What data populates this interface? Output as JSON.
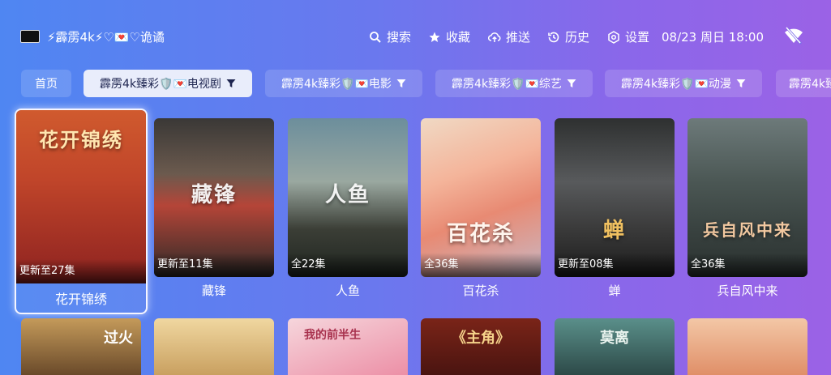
{
  "header": {
    "brand": "⚡霹雳4k⚡♡💌♡诡谲",
    "nav": [
      {
        "icon": "search-icon",
        "label": "搜索"
      },
      {
        "icon": "star-icon",
        "label": "收藏"
      },
      {
        "icon": "cloud-upload-icon",
        "label": "推送"
      },
      {
        "icon": "history-icon",
        "label": "历史"
      },
      {
        "icon": "settings-icon",
        "label": "设置"
      }
    ],
    "datetime": "08/23 周日 18:00",
    "status_icon": "wifi-off-icon"
  },
  "tabs": [
    {
      "label": "首页"
    },
    {
      "label": "霹雳4k臻彩🛡️💌电视剧",
      "active": true
    },
    {
      "label": "霹雳4k臻彩🛡️💌电影"
    },
    {
      "label": "霹雳4k臻彩🛡️💌综艺"
    },
    {
      "label": "霹雳4k臻彩🛡️💌动漫"
    },
    {
      "label": "霹雳4k臻"
    }
  ],
  "cards": [
    {
      "title": "花开锦绣",
      "episodes": "更新至27集",
      "poster_text": "花开锦绣"
    },
    {
      "title": "藏锋",
      "episodes": "更新至11集",
      "poster_text": "藏锋"
    },
    {
      "title": "人鱼",
      "episodes": "全22集",
      "poster_text": "人鱼"
    },
    {
      "title": "百花杀",
      "episodes": "全36集",
      "poster_text": "百花杀"
    },
    {
      "title": "蝉",
      "episodes": "更新至08集",
      "poster_text": "蝉"
    },
    {
      "title": "兵自风中来",
      "episodes": "全36集",
      "poster_text": "兵自风中来"
    }
  ],
  "row2": [
    {
      "poster_text": "过火"
    },
    {
      "poster_text": ""
    },
    {
      "poster_text": "我的前半生"
    },
    {
      "poster_text": "《主角》"
    },
    {
      "poster_text": "莫离"
    },
    {
      "poster_text": ""
    }
  ],
  "colors": {
    "active_tab_bg": "#e9edfb",
    "gradient_start": "#4f86f2",
    "gradient_end": "#9b62e6"
  }
}
